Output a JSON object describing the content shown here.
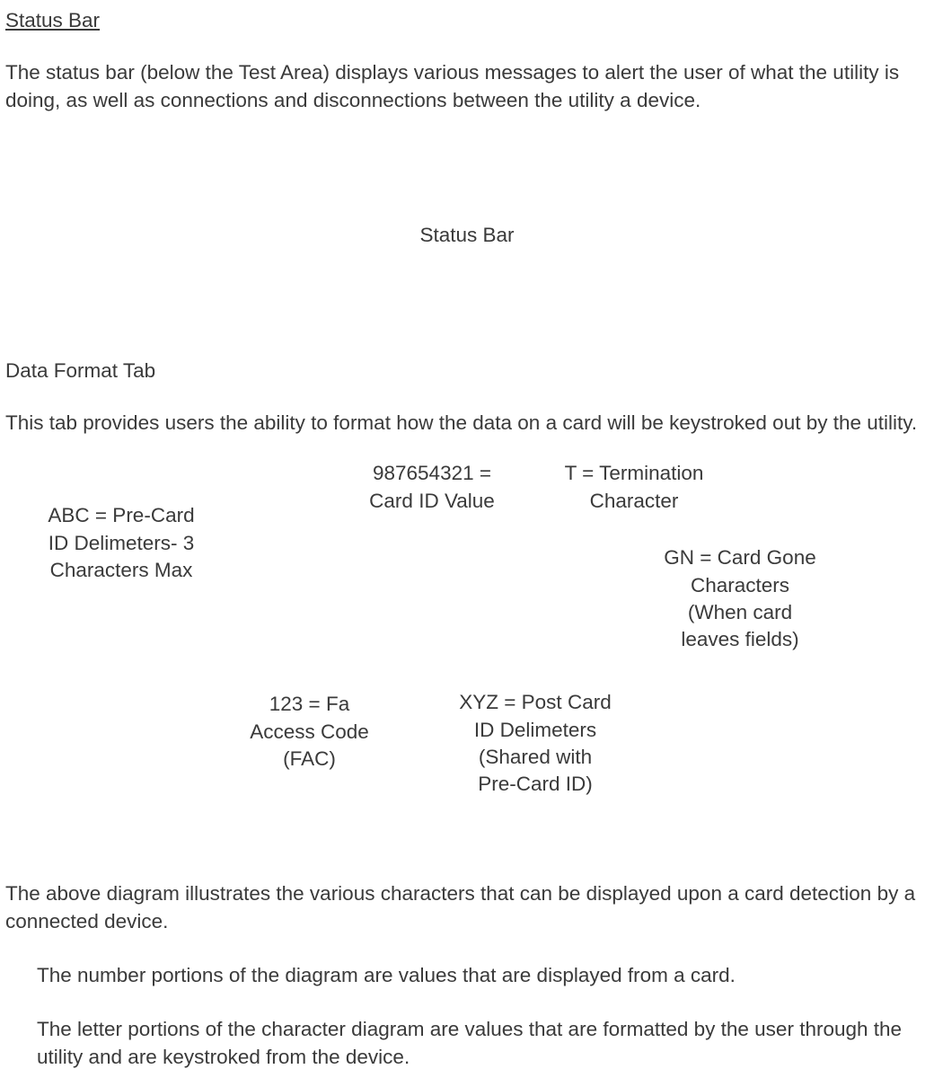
{
  "statusBar": {
    "title": "Status Bar",
    "description": "The status bar (below the Test Area) displays various messages to alert the user of what the utility is doing, as well as connections and disconnections between the utility a device.",
    "centerLabel": "Status Bar"
  },
  "dataFormat": {
    "title": "Data Format Tab",
    "description": "This tab provides users the ability to format how the data on a card will be keystroked out by the utility.",
    "callouts": {
      "abc": {
        "l1": "ABC = Pre-Card",
        "l2": "ID Delimeters- 3",
        "l3": "Characters Max"
      },
      "num987": {
        "l1": "987654321 =",
        "l2": "Card ID Value"
      },
      "term": {
        "l1": "T = Termination",
        "l2": "Character"
      },
      "gn": {
        "l1": "GN = Card Gone",
        "l2": "Characters",
        "l3": "(When card",
        "l4": "leaves fields)"
      },
      "fac": {
        "l1": "123 = Fa",
        "l2": "Access Code",
        "l3": "(FAC)"
      },
      "xyz": {
        "l1": "XYZ = Post Card",
        "l2": "ID Delimeters",
        "l3": "(Shared with",
        "l4": "Pre-Card ID)"
      }
    },
    "bottomPara": "The above diagram illustrates the various characters that can be displayed upon a card detection by a connected device.",
    "indent1": "The number portions of the diagram are values that are displayed from a card.",
    "indent2": "The letter portions of the character diagram are values that are formatted by the user through the utility and are keystroked from the device."
  }
}
